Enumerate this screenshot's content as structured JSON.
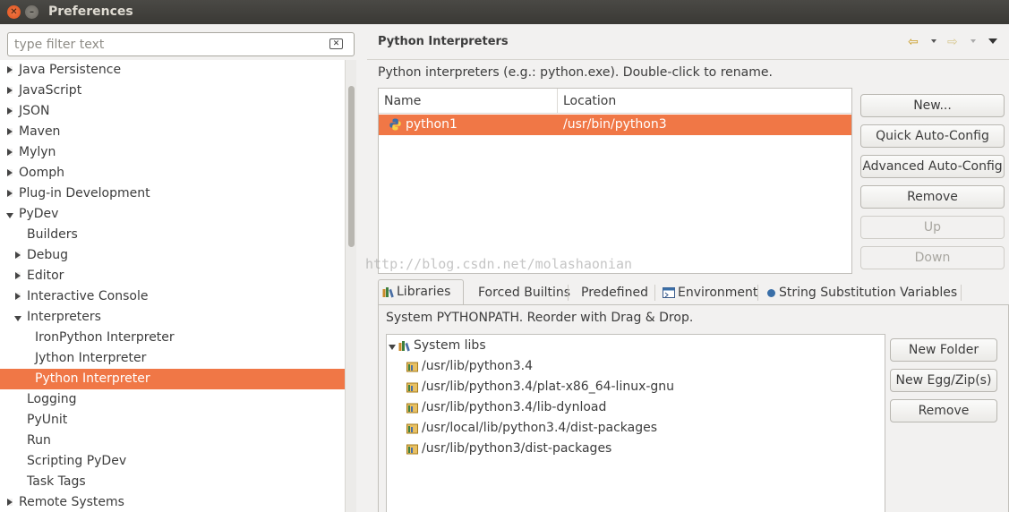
{
  "window": {
    "title": "Preferences"
  },
  "filter": {
    "placeholder": "type filter text"
  },
  "tree": [
    {
      "label": "Java Persistence",
      "level": 0,
      "expander": "collapsed",
      "selected": false
    },
    {
      "label": "JavaScript",
      "level": 0,
      "expander": "collapsed",
      "selected": false
    },
    {
      "label": "JSON",
      "level": 0,
      "expander": "collapsed",
      "selected": false
    },
    {
      "label": "Maven",
      "level": 0,
      "expander": "collapsed",
      "selected": false
    },
    {
      "label": "Mylyn",
      "level": 0,
      "expander": "collapsed",
      "selected": false
    },
    {
      "label": "Oomph",
      "level": 0,
      "expander": "collapsed",
      "selected": false
    },
    {
      "label": "Plug-in Development",
      "level": 0,
      "expander": "collapsed",
      "selected": false
    },
    {
      "label": "PyDev",
      "level": 0,
      "expander": "expanded",
      "selected": false
    },
    {
      "label": "Builders",
      "level": 1,
      "expander": "none",
      "selected": false
    },
    {
      "label": "Debug",
      "level": 1,
      "expander": "collapsed",
      "selected": false
    },
    {
      "label": "Editor",
      "level": 1,
      "expander": "collapsed",
      "selected": false
    },
    {
      "label": "Interactive Console",
      "level": 1,
      "expander": "collapsed",
      "selected": false
    },
    {
      "label": "Interpreters",
      "level": 1,
      "expander": "expanded",
      "selected": false
    },
    {
      "label": "IronPython Interpreter",
      "level": 2,
      "expander": "none",
      "selected": false
    },
    {
      "label": "Jython Interpreter",
      "level": 2,
      "expander": "none",
      "selected": false
    },
    {
      "label": "Python Interpreter",
      "level": 2,
      "expander": "none",
      "selected": true
    },
    {
      "label": "Logging",
      "level": 1,
      "expander": "none",
      "selected": false
    },
    {
      "label": "PyUnit",
      "level": 1,
      "expander": "none",
      "selected": false
    },
    {
      "label": "Run",
      "level": 1,
      "expander": "none",
      "selected": false
    },
    {
      "label": "Scripting PyDev",
      "level": 1,
      "expander": "none",
      "selected": false
    },
    {
      "label": "Task Tags",
      "level": 1,
      "expander": "none",
      "selected": false
    },
    {
      "label": "Remote Systems",
      "level": 0,
      "expander": "collapsed",
      "selected": false
    }
  ],
  "page": {
    "title": "Python Interpreters",
    "description": "Python interpreters (e.g.: python.exe).  Double-click to rename."
  },
  "interpreters": {
    "columns": [
      "Name",
      "Location"
    ],
    "rows": [
      {
        "name": "python1",
        "location": "/usr/bin/python3",
        "selected": true
      }
    ]
  },
  "interp_buttons": [
    {
      "label": "New...",
      "enabled": true
    },
    {
      "label": "Quick Auto-Config",
      "enabled": true
    },
    {
      "label": "Advanced Auto-Config",
      "enabled": true
    },
    {
      "label": "Remove",
      "enabled": true
    },
    {
      "label": "Up",
      "enabled": false
    },
    {
      "label": "Down",
      "enabled": false
    }
  ],
  "tabs": [
    {
      "label": "Libraries",
      "active": true,
      "icon": "libraries-icon"
    },
    {
      "label": "Forced Builtins",
      "active": false,
      "icon": ""
    },
    {
      "label": "Predefined",
      "active": false,
      "icon": ""
    },
    {
      "label": "Environment",
      "active": false,
      "icon": "environment-icon"
    },
    {
      "label": "String Substitution Variables",
      "active": false,
      "icon": "variable-dot-icon"
    }
  ],
  "libraries": {
    "description": "System PYTHONPATH.   Reorder with Drag & Drop.",
    "root": "System libs",
    "paths": [
      "/usr/lib/python3.4",
      "/usr/lib/python3.4/plat-x86_64-linux-gnu",
      "/usr/lib/python3.4/lib-dynload",
      "/usr/local/lib/python3.4/dist-packages",
      "/usr/lib/python3/dist-packages"
    ]
  },
  "lib_buttons": [
    "New Folder",
    "New Egg/Zip(s)",
    "Remove"
  ],
  "watermark": "http://blog.csdn.net/molashaonian",
  "colors": {
    "selection": "#f07746",
    "titlebar": "#3c3b37"
  }
}
